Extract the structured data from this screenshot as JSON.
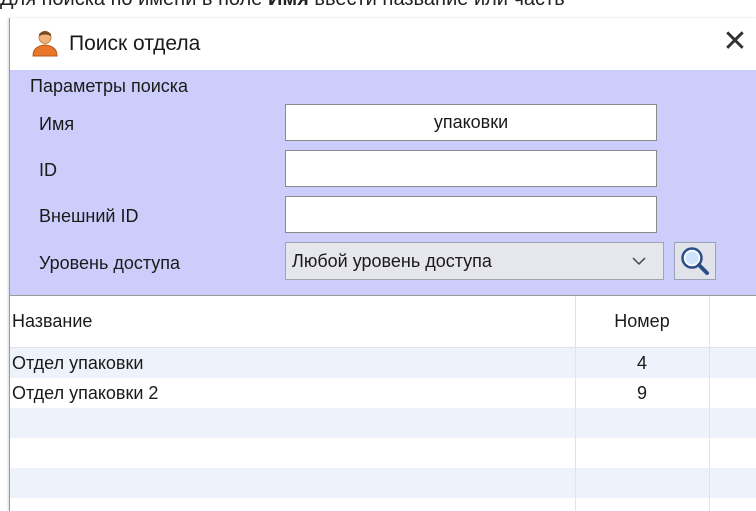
{
  "instruction": {
    "prefix": "Для поиска по имени в поле ",
    "bold": "Имя",
    "suffix": " ввести название или часть"
  },
  "window": {
    "title": "Поиск отдела",
    "icon": "user-icon",
    "close_label": "✕"
  },
  "params": {
    "legend": "Параметры поиска",
    "name_label": "Имя",
    "name_value": "упаковки",
    "id_label": "ID",
    "id_value": "",
    "external_id_label": "Внешний ID",
    "external_id_value": "",
    "access_label": "Уровень доступа",
    "access_value": "Любой уровень доступа",
    "search_icon": "search-icon"
  },
  "grid": {
    "columns": [
      "Название",
      "Номер"
    ],
    "rows": [
      {
        "name": "Отдел упаковки",
        "number": "4"
      },
      {
        "name": "Отдел упаковки 2",
        "number": "9"
      }
    ]
  },
  "colors": {
    "params_background": "#cdcdfb",
    "row_alt": "#eef3fb",
    "select_background": "#e6e6ed"
  }
}
